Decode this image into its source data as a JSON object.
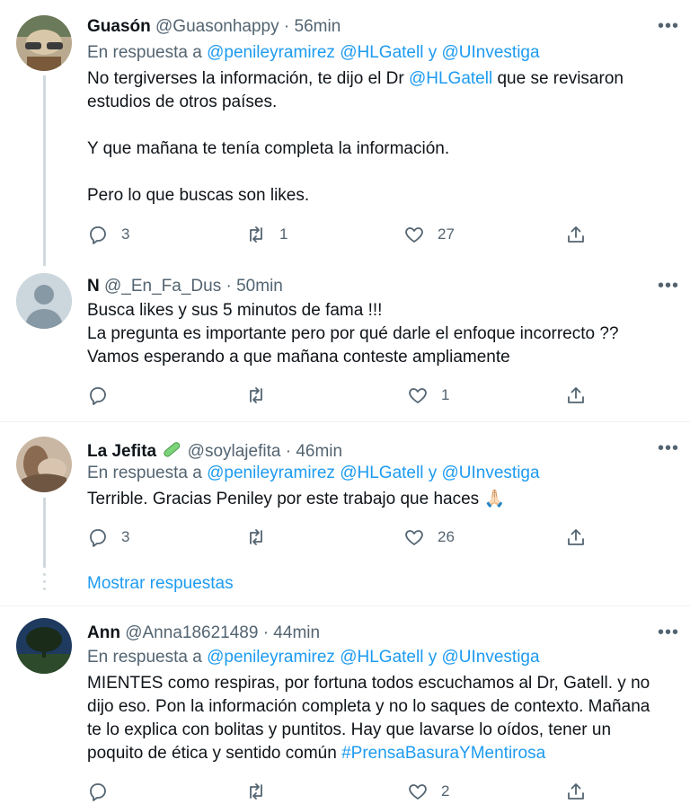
{
  "tweets": [
    {
      "name": "Guasón",
      "handle": "@Guasonhappy",
      "time": "· 56min",
      "reply_prefix": "En respuesta a",
      "reply_m1": "@penileyramirez",
      "reply_m2": "@HLGatell",
      "reply_and": "y",
      "reply_m3": "@UInvestiga",
      "text_l1_a": "No tergiverses la información, te dijo el Dr",
      "text_l1_m": "@HLGatell",
      "text_l1_b": " que se revisaron",
      "text_l2": "estudios de otros países.",
      "text_l3": "Y que mañana te tenía completa la información.",
      "text_l4": "Pero lo que buscas son likes.",
      "replies": "3",
      "retweets": "1",
      "likes": "27"
    },
    {
      "name": "N",
      "handle": "@_En_Fa_Dus",
      "time": "· 50min",
      "text_l1": "Busca likes y sus 5 minutos de fama !!!",
      "text_l2": "La pregunta es importante pero por qué darle el enfoque incorrecto ??",
      "text_l3": "Vamos esperando a que mañana conteste ampliamente",
      "likes": "1"
    },
    {
      "name": "La Jefita",
      "handle": "@soylajefita",
      "time": "· 46min",
      "reply_prefix": "En respuesta a",
      "reply_m1": "@penileyramirez",
      "reply_m2": "@HLGatell",
      "reply_and": "y",
      "reply_m3": "@UInvestiga",
      "text_l1": "Terrible. Gracias Peniley por este trabajo que haces",
      "text_emoji": "🙏🏻",
      "replies": "3",
      "likes": "26",
      "show_replies": "Mostrar respuestas"
    },
    {
      "name": "Ann",
      "handle": "@Anna18621489",
      "time": "· 44min",
      "reply_prefix": "En respuesta a",
      "reply_m1": "@penileyramirez",
      "reply_m2": "@HLGatell",
      "reply_and": "y",
      "reply_m3": "@UInvestiga",
      "text_l1": "MIENTES como respiras, por fortuna todos escuchamos al Dr, Gatell. y no",
      "text_l2": "dijo eso. Pon la información completa y no lo saques de contexto. Mañana",
      "text_l3": "te lo explica con bolitas y puntitos. Hay que lavarse lo oídos, tener un",
      "text_l4a": "poquito de ética y  sentido común",
      "text_l4_hashtag": "#PrensaBasuraYMentirosa",
      "likes": "2"
    }
  ],
  "colors": {
    "accent": "#1d9bf0",
    "secondary_text": "#536471",
    "thread_line": "#cfd9de",
    "divider": "#eff3f4",
    "verified_emoji_color": "#7bd37a"
  },
  "icons": [
    "reply-icon",
    "retweet-icon",
    "like-icon",
    "share-icon",
    "more-icon",
    "test-tube-icon"
  ]
}
